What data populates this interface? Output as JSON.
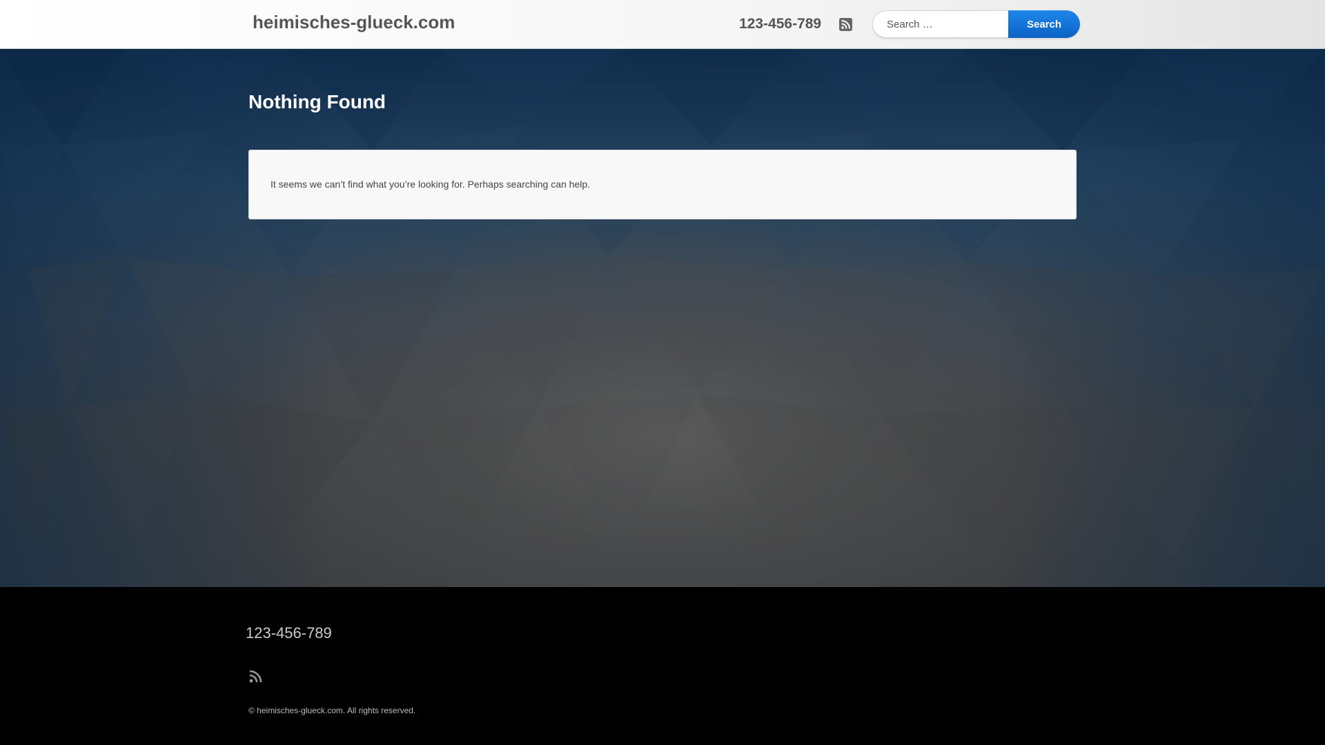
{
  "header": {
    "site_title": "heimisches-glueck.com",
    "phone": "123-456-789",
    "rss_icon": "rss-icon",
    "search": {
      "placeholder": "Search …",
      "button_label": "Search"
    }
  },
  "main": {
    "title": "Nothing Found",
    "message": "It seems we can’t find what you’re looking for. Perhaps searching can help."
  },
  "footer": {
    "phone": "123-456-789",
    "rss_icon": "rss-icon",
    "copyright": "© heimisches-glueck.com. All rights reserved."
  },
  "colors": {
    "accent": "#0b6fd6",
    "header_text": "#555555",
    "footer_bg": "#000000"
  }
}
